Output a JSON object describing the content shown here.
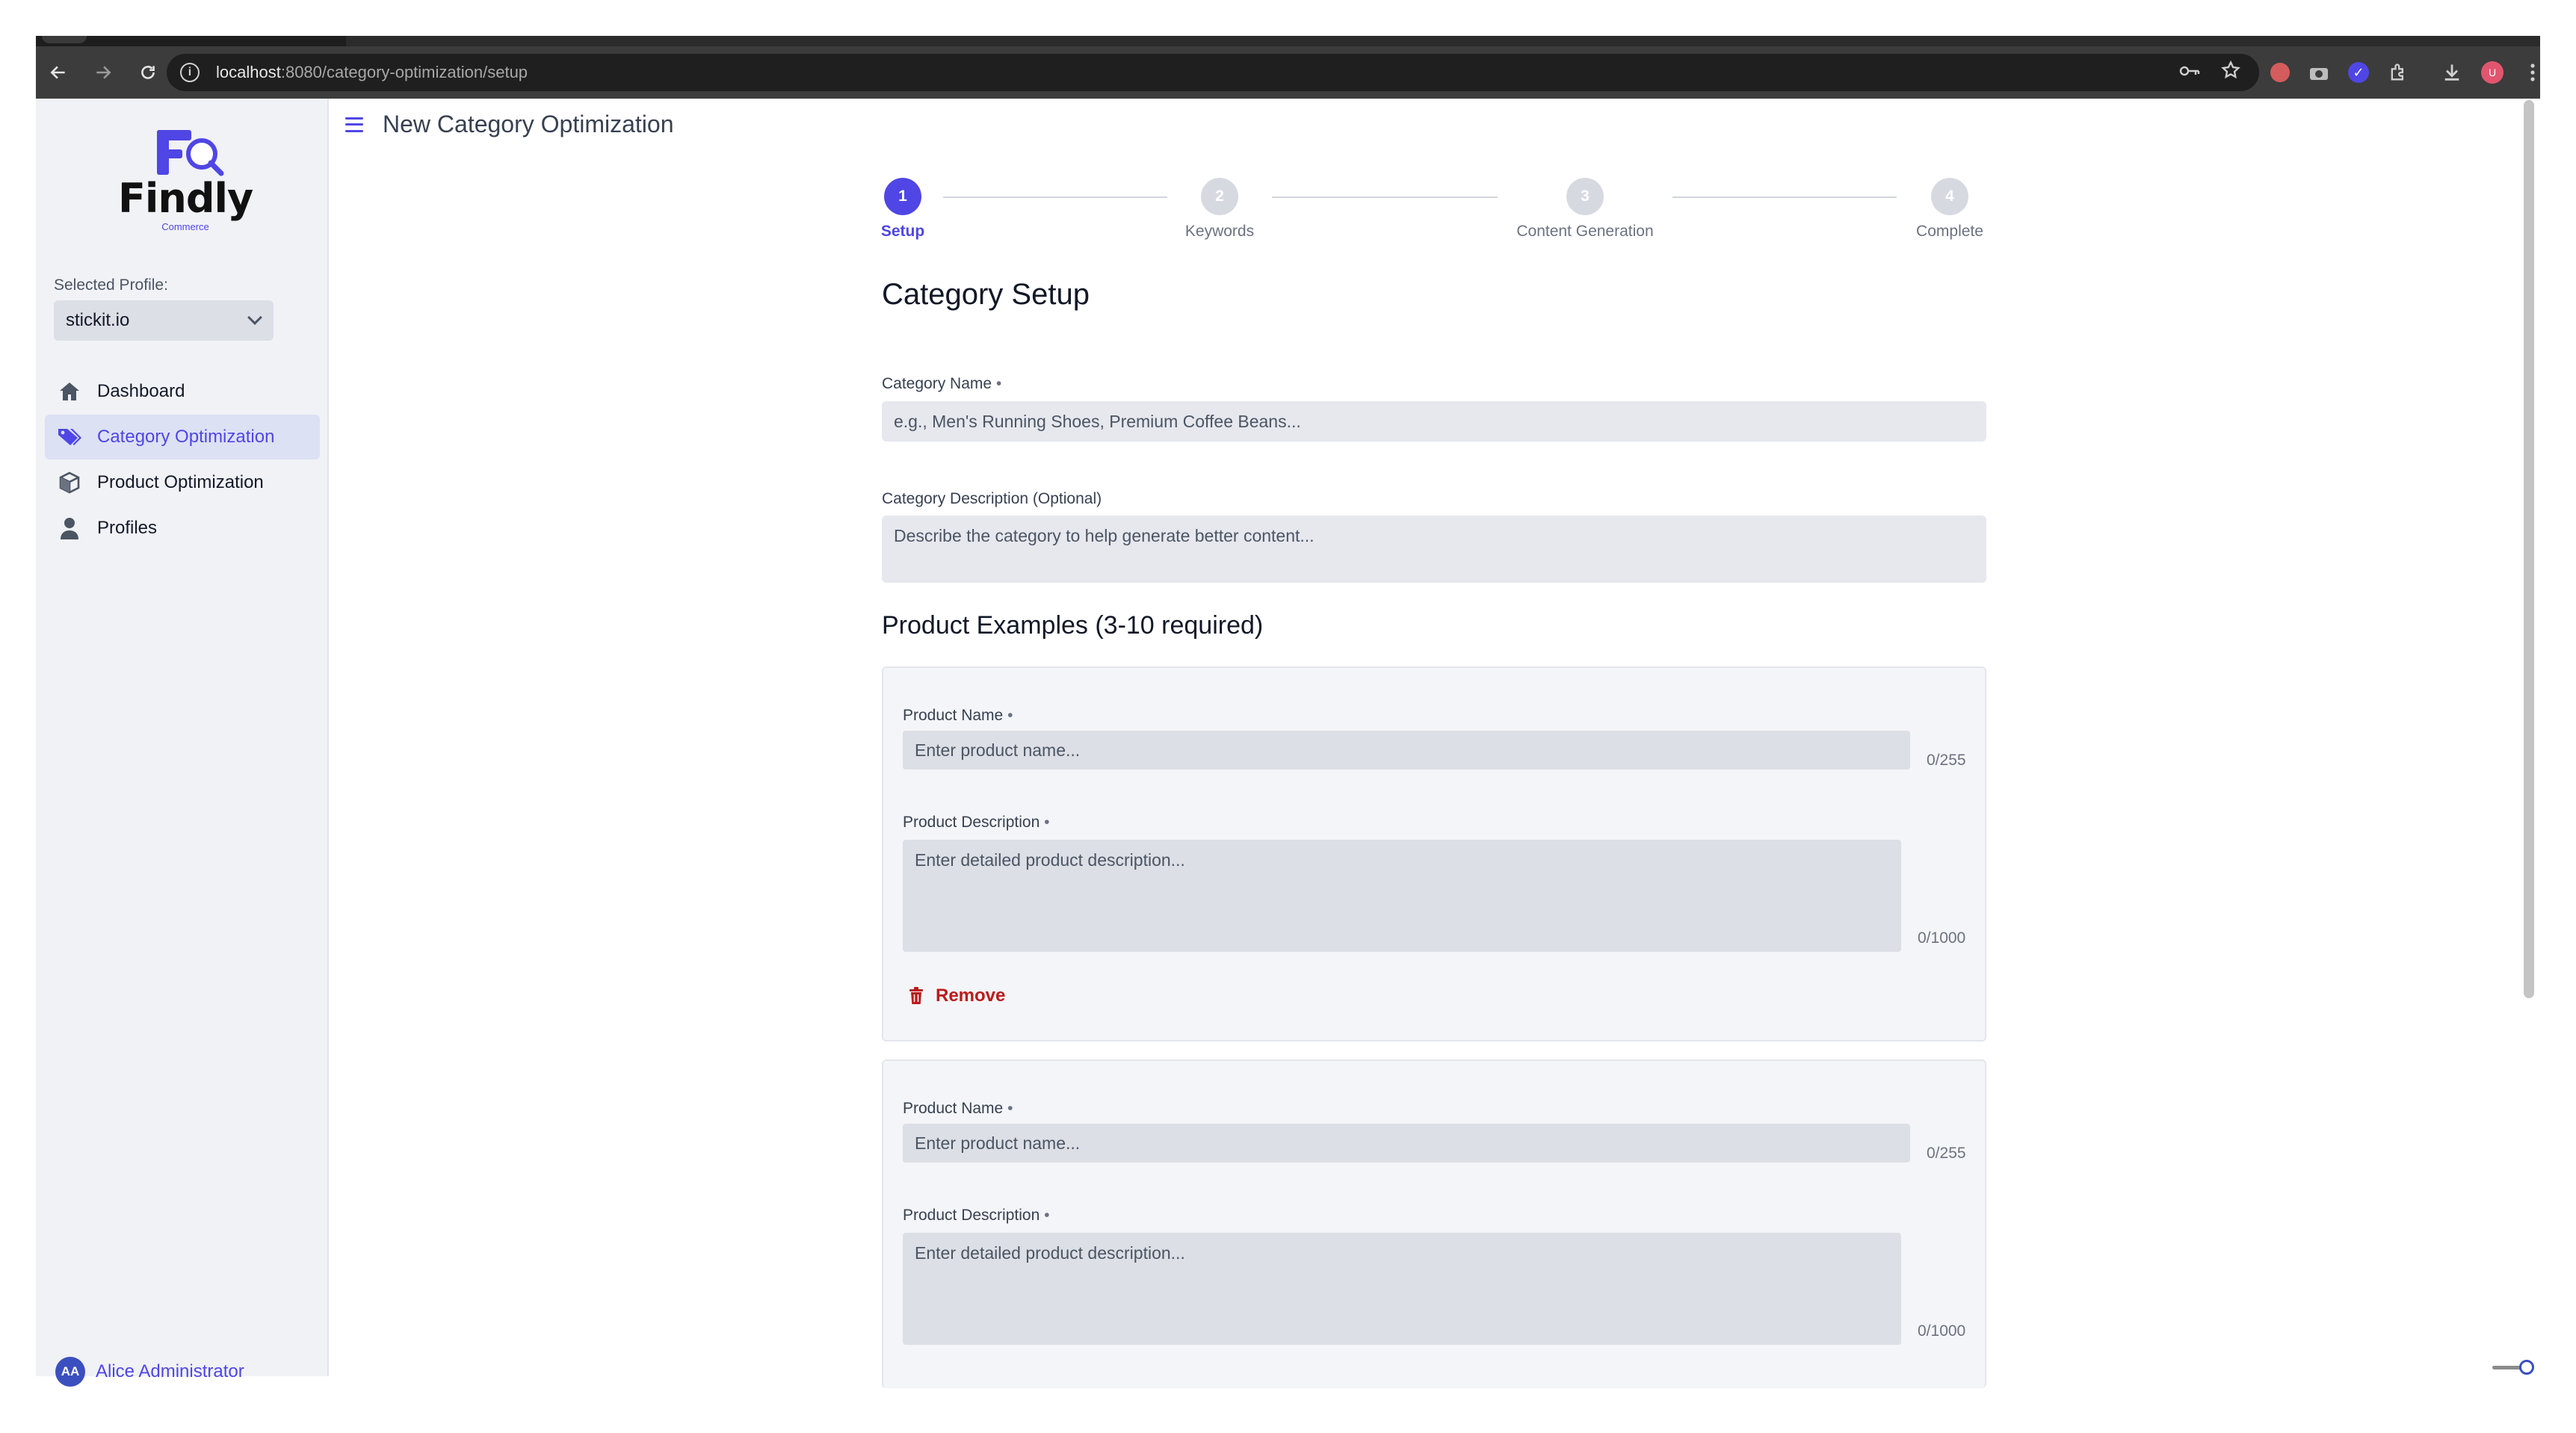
{
  "browser": {
    "url_host": "localhost",
    "url_path": ":8080/category-optimization/setup",
    "avatar_letter": "U"
  },
  "sidebar": {
    "logo_word": "Findly",
    "logo_sub": "Commerce",
    "profile_label": "Selected Profile:",
    "profile_value": "stickit.io",
    "items": [
      {
        "label": "Dashboard",
        "icon": "home-icon"
      },
      {
        "label": "Category Optimization",
        "icon": "tags-icon"
      },
      {
        "label": "Product Optimization",
        "icon": "box-icon"
      },
      {
        "label": "Profiles",
        "icon": "user-icon"
      }
    ],
    "active_index": 1,
    "user_initials": "AA",
    "user_name": "Alice Administrator"
  },
  "header": {
    "title": "New Category Optimization"
  },
  "stepper": {
    "steps": [
      {
        "number": "1",
        "label": "Setup"
      },
      {
        "number": "2",
        "label": "Keywords"
      },
      {
        "number": "3",
        "label": "Content Generation"
      },
      {
        "number": "4",
        "label": "Complete"
      }
    ],
    "active_index": 0
  },
  "form": {
    "section_title": "Category Setup",
    "category_name_label": "Category Name",
    "required_mark": "•",
    "category_name_placeholder": "e.g., Men's Running Shoes, Premium Coffee Beans...",
    "category_desc_label": "Category Description (Optional)",
    "category_desc_placeholder": "Describe the category to help generate better content...",
    "examples_title": "Product Examples (3-10 required)",
    "products": [
      {
        "name_label": "Product Name",
        "name_placeholder": "Enter product name...",
        "name_count": "0/255",
        "desc_label": "Product Description",
        "desc_placeholder": "Enter detailed product description...",
        "desc_count": "0/1000",
        "remove_label": "Remove"
      },
      {
        "name_label": "Product Name",
        "name_placeholder": "Enter product name...",
        "name_count": "0/255",
        "desc_label": "Product Description",
        "desc_placeholder": "Enter detailed product description...",
        "desc_count": "0/1000"
      }
    ]
  },
  "colors": {
    "accent": "#4f46e5",
    "danger": "#b91c1c",
    "sidebar_bg": "#f1f2f6",
    "input_bg": "#e6e8ee"
  }
}
